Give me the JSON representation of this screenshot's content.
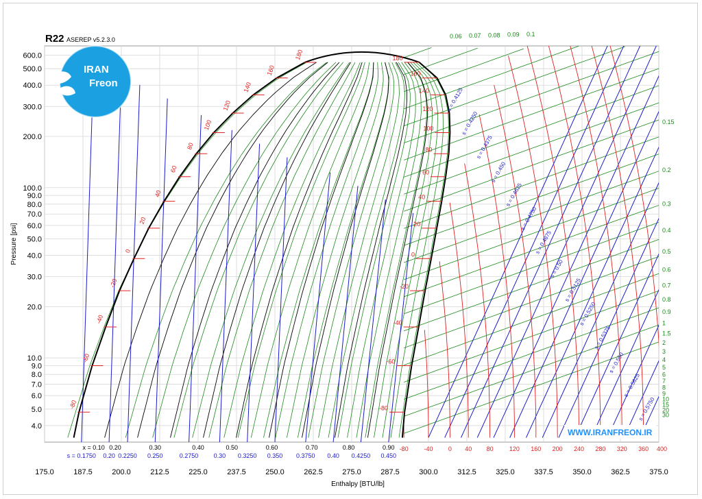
{
  "header": {
    "title": "R22",
    "version": "ASEREP v5.2.3.0"
  },
  "logo": {
    "line1": "IRAN",
    "line2": "Freon",
    "color": "#1ba1e2"
  },
  "website": "WWW.IRANFREON.IR",
  "colors": {
    "saturation": "#000000",
    "isotherm": "#e02020",
    "isentrope": "#1a1acc",
    "isochore": "#1a8a1a",
    "quality": "#000000"
  },
  "chart_data": {
    "type": "line",
    "title": "R22",
    "xlabel": "Enthalpy [BTU/lb]",
    "ylabel": "Pressure [psi]",
    "xlim": [
      175,
      375
    ],
    "ylim": [
      3.2,
      680
    ],
    "yscale": "log",
    "grid": true,
    "x_ticks": [
      "175.0",
      "187.5",
      "200.0",
      "212.5",
      "225.0",
      "237.5",
      "250.0",
      "262.5",
      "275.0",
      "287.5",
      "300.0",
      "312.5",
      "325.0",
      "337.5",
      "350.0",
      "362.5",
      "375.0"
    ],
    "y_ticks": [
      {
        "v": 4,
        "label": "4.0"
      },
      {
        "v": 5,
        "label": "5.0"
      },
      {
        "v": 6,
        "label": "6.0"
      },
      {
        "v": 7,
        "label": "7.0"
      },
      {
        "v": 8,
        "label": "8.0"
      },
      {
        "v": 9,
        "label": "9.0"
      },
      {
        "v": 10,
        "label": "10.0"
      },
      {
        "v": 20,
        "label": "20.0"
      },
      {
        "v": 30,
        "label": "30.0"
      },
      {
        "v": 40,
        "label": "40.0"
      },
      {
        "v": 50,
        "label": "50.0"
      },
      {
        "v": 60,
        "label": "60.0"
      },
      {
        "v": 70,
        "label": "70.0"
      },
      {
        "v": 80,
        "label": "80.0"
      },
      {
        "v": 90,
        "label": "90.0"
      },
      {
        "v": 100,
        "label": "100.0"
      },
      {
        "v": 200,
        "label": "200.0"
      },
      {
        "v": 300,
        "label": "300.0"
      },
      {
        "v": 400,
        "label": "400.0"
      },
      {
        "v": 500,
        "label": "500.0"
      },
      {
        "v": 600,
        "label": "600.0"
      }
    ],
    "quality_ticks": [
      {
        "label": "x = 0.10",
        "h": 191
      },
      {
        "label": "0.20",
        "h": 198
      },
      {
        "label": "0.30",
        "h": 211
      },
      {
        "label": "0.40",
        "h": 225
      },
      {
        "label": "0.50",
        "h": 236
      },
      {
        "label": "0.60",
        "h": 249
      },
      {
        "label": "0.70",
        "h": 262
      },
      {
        "label": "0.80",
        "h": 274
      },
      {
        "label": "0.90",
        "h": 287
      }
    ],
    "entropy_ticks": [
      {
        "label": "s = 0.1750",
        "h": 187
      },
      {
        "label": "0.20",
        "h": 196
      },
      {
        "label": "0.2250",
        "h": 202
      },
      {
        "label": "0.250",
        "h": 211
      },
      {
        "label": "0.2750",
        "h": 222
      },
      {
        "label": "0.30",
        "h": 232
      },
      {
        "label": "0.3250",
        "h": 241
      },
      {
        "label": "0.350",
        "h": 250
      },
      {
        "label": "0.3750",
        "h": 260
      },
      {
        "label": "0.40",
        "h": 269
      },
      {
        "label": "0.4250",
        "h": 278
      },
      {
        "label": "0.450",
        "h": 287
      }
    ],
    "temp_ticks": [
      {
        "label": "-80",
        "h": 292
      },
      {
        "label": "-40",
        "h": 300
      },
      {
        "label": "0",
        "h": 307
      },
      {
        "label": "40",
        "h": 313
      },
      {
        "label": "80",
        "h": 320
      },
      {
        "label": "120",
        "h": 328
      },
      {
        "label": "160",
        "h": 335
      },
      {
        "label": "200",
        "h": 342
      },
      {
        "label": "240",
        "h": 349
      },
      {
        "label": "280",
        "h": 356
      },
      {
        "label": "320",
        "h": 363
      },
      {
        "label": "360",
        "h": 370
      },
      {
        "label": "400",
        "h": 376
      }
    ],
    "saturation": [
      {
        "T": -80,
        "P": 4.8,
        "hf": 186.2,
        "hg": 292.2
      },
      {
        "T": -60,
        "P": 9.0,
        "hf": 190.5,
        "hg": 294.5
      },
      {
        "T": -40,
        "P": 15.2,
        "hf": 194.9,
        "hg": 296.8
      },
      {
        "T": -20,
        "P": 24.8,
        "hf": 199.4,
        "hg": 298.9
      },
      {
        "T": 0,
        "P": 38.3,
        "hf": 204.1,
        "hg": 300.9
      },
      {
        "T": 20,
        "P": 57.8,
        "hf": 208.9,
        "hg": 302.7
      },
      {
        "T": 40,
        "P": 83.2,
        "hf": 213.9,
        "hg": 304.3
      },
      {
        "T": 60,
        "P": 116.0,
        "hf": 219.0,
        "hg": 305.6
      },
      {
        "T": 80,
        "P": 158.2,
        "hf": 224.4,
        "hg": 306.6
      },
      {
        "T": 100,
        "P": 210.5,
        "hf": 230.1,
        "hg": 307.0
      },
      {
        "T": 120,
        "P": 274.0,
        "hf": 236.3,
        "hg": 306.8
      },
      {
        "T": 140,
        "P": 351.0,
        "hf": 243.0,
        "hg": 305.6
      },
      {
        "T": 160,
        "P": 441.0,
        "hf": 250.6,
        "hg": 302.8
      },
      {
        "T": 180,
        "P": 545.0,
        "hf": 259.8,
        "hg": 297.0
      }
    ],
    "critical_point": {
      "h": 278,
      "P": 721.9
    },
    "isotherm_labels": [
      "-80",
      "-60",
      "-40",
      "-20",
      "0",
      "20",
      "40",
      "60",
      "80",
      "100",
      "120",
      "140",
      "160",
      "180"
    ],
    "vapor_isotherms": [
      -80,
      -40,
      0,
      40,
      80,
      120,
      160,
      200,
      240,
      280,
      320,
      360,
      400
    ],
    "isentropes": [
      {
        "label": "s = 0.4125",
        "s": 0.4125
      },
      {
        "label": "s = 0.4250",
        "s": 0.425
      },
      {
        "label": "s = 0.4375",
        "s": 0.4375
      },
      {
        "label": "s = 0.450",
        "s": 0.45
      },
      {
        "label": "s = 0.4625",
        "s": 0.4625
      },
      {
        "label": "s = 0.4750",
        "s": 0.475
      },
      {
        "label": "s = 0.4875",
        "s": 0.4875
      },
      {
        "label": "s = 0.50",
        "s": 0.5
      },
      {
        "label": "s = 0.5125",
        "s": 0.5125
      },
      {
        "label": "s = 0.5250",
        "s": 0.525
      },
      {
        "label": "s = 0.5375",
        "s": 0.5375
      },
      {
        "label": "s = 0.550",
        "s": 0.55
      },
      {
        "label": "s = 0.5625",
        "s": 0.5625
      },
      {
        "label": "s = 0.5750",
        "s": 0.575
      }
    ],
    "isochores": [
      "0.06",
      "0.07",
      "0.08",
      "0.09",
      "0.1",
      "0.15",
      "0.2",
      "0.3",
      "0.4",
      "0.5",
      "0.6",
      "0.7",
      "0.8",
      "0.9",
      "1",
      "1.5",
      "2",
      "3",
      "4",
      "5",
      "6",
      "7",
      "8",
      "9",
      "10",
      "15",
      "20",
      "30"
    ],
    "qualities": [
      0.1,
      0.2,
      0.3,
      0.4,
      0.5,
      0.6,
      0.7,
      0.8,
      0.9
    ]
  }
}
